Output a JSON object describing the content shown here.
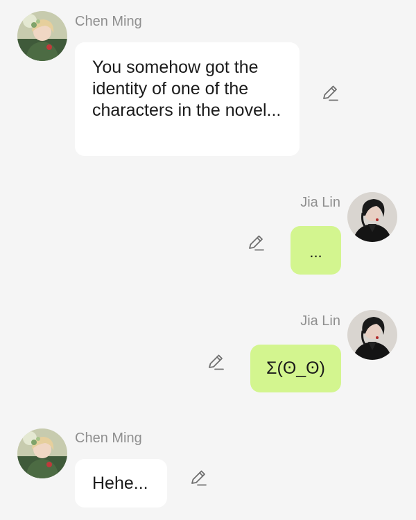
{
  "colors": {
    "background": "#f5f5f5",
    "incoming_bubble": "#ffffff",
    "outgoing_bubble": "#d3f58f",
    "sender_name": "#8f8f8f",
    "message_text": "#1b1b1b",
    "icon_stroke": "#6f6f6f"
  },
  "messages": [
    {
      "sender": "Chen Ming",
      "side": "left",
      "avatar_icon": "avatar-chen-ming-icon",
      "text": "You somehow got the identity of one of the characters in the novel...",
      "action_icon": "pencil-icon"
    },
    {
      "sender": "Jia Lin",
      "side": "right",
      "avatar_icon": "avatar-jia-lin-icon",
      "text": "...",
      "action_icon": "pencil-icon"
    },
    {
      "sender": "Jia Lin",
      "side": "right",
      "avatar_icon": "avatar-jia-lin-icon",
      "text": "Σ(ʘ_ʘ)",
      "action_icon": "pencil-icon"
    },
    {
      "sender": "Chen Ming",
      "side": "left",
      "avatar_icon": "avatar-chen-ming-icon",
      "text": "Hehe...",
      "action_icon": "pencil-icon"
    }
  ]
}
